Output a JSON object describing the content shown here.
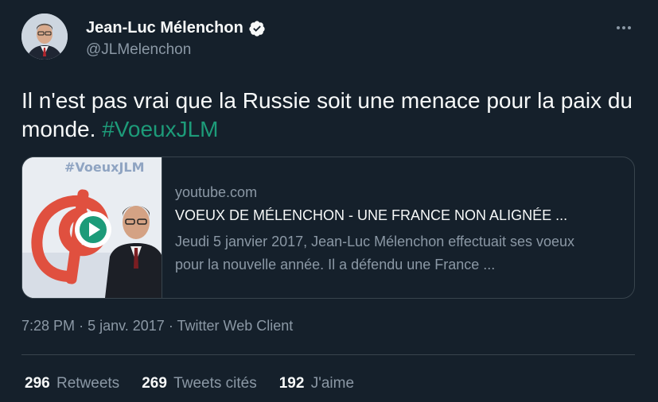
{
  "author": {
    "name": "Jean-Luc Mélenchon",
    "handle": "@JLMelenchon",
    "verified": true
  },
  "tweet": {
    "text": "Il n'est pas vrai que la Russie soit une menace pour la paix du monde.",
    "hashtag": "#VoeuxJLM"
  },
  "card": {
    "thumbnail_text": "#VoeuxJLM",
    "domain": "youtube.com",
    "title": "VOEUX DE MÉLENCHON - UNE FRANCE NON ALIGNÉE ...",
    "description": "Jeudi 5 janvier 2017, Jean-Luc Mélenchon effectuait ses voeux pour la nouvelle année. Il a défendu une France ..."
  },
  "meta": {
    "time": "7:28 PM",
    "separator": "·",
    "date": "5 janv. 2017",
    "source": "Twitter Web Client"
  },
  "stats": {
    "retweets_count": "296",
    "retweets_label": "Retweets",
    "quotes_count": "269",
    "quotes_label": "Tweets cités",
    "likes_count": "192",
    "likes_label": "J'aime"
  },
  "colors": {
    "background": "#15202b",
    "hashtag": "#1d9b79",
    "secondary_text": "#8b98a5",
    "border": "#38444d",
    "verified_badge": "#f7f9f9",
    "play_icon": "#1d9b79"
  },
  "icons": [
    "verified-badge-icon",
    "more-options-icon",
    "play-icon"
  ]
}
